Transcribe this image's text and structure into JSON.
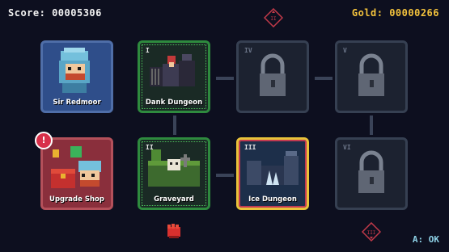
{
  "hud": {
    "score": "Score: 00005306",
    "gold": "Gold: 00000266"
  },
  "tiles": [
    {
      "label": "Sir Redmoor",
      "numeral": ""
    },
    {
      "label": "Dank Dungeon",
      "numeral": "I"
    },
    {
      "label": "",
      "numeral": "IV"
    },
    {
      "label": "",
      "numeral": "V"
    },
    {
      "label": "Upgrade Shop",
      "numeral": ""
    },
    {
      "label": "Graveyard",
      "numeral": "II"
    },
    {
      "label": "Ice Dungeon",
      "numeral": "III"
    },
    {
      "label": "",
      "numeral": "VI"
    }
  ],
  "nav": {
    "up_label": "II",
    "down_label": "III"
  },
  "alert_badge": "!",
  "prompt": "A: OK",
  "colors": {
    "selected_border": "#e9c33a",
    "completed_border": "#2e8a3e",
    "gold_text": "#f3c23c"
  },
  "icons": {
    "up": "up-arrow-icon",
    "down": "down-arrow-icon",
    "lock": "padlock-icon",
    "cursor": "red-gauntlet-cursor-icon"
  }
}
